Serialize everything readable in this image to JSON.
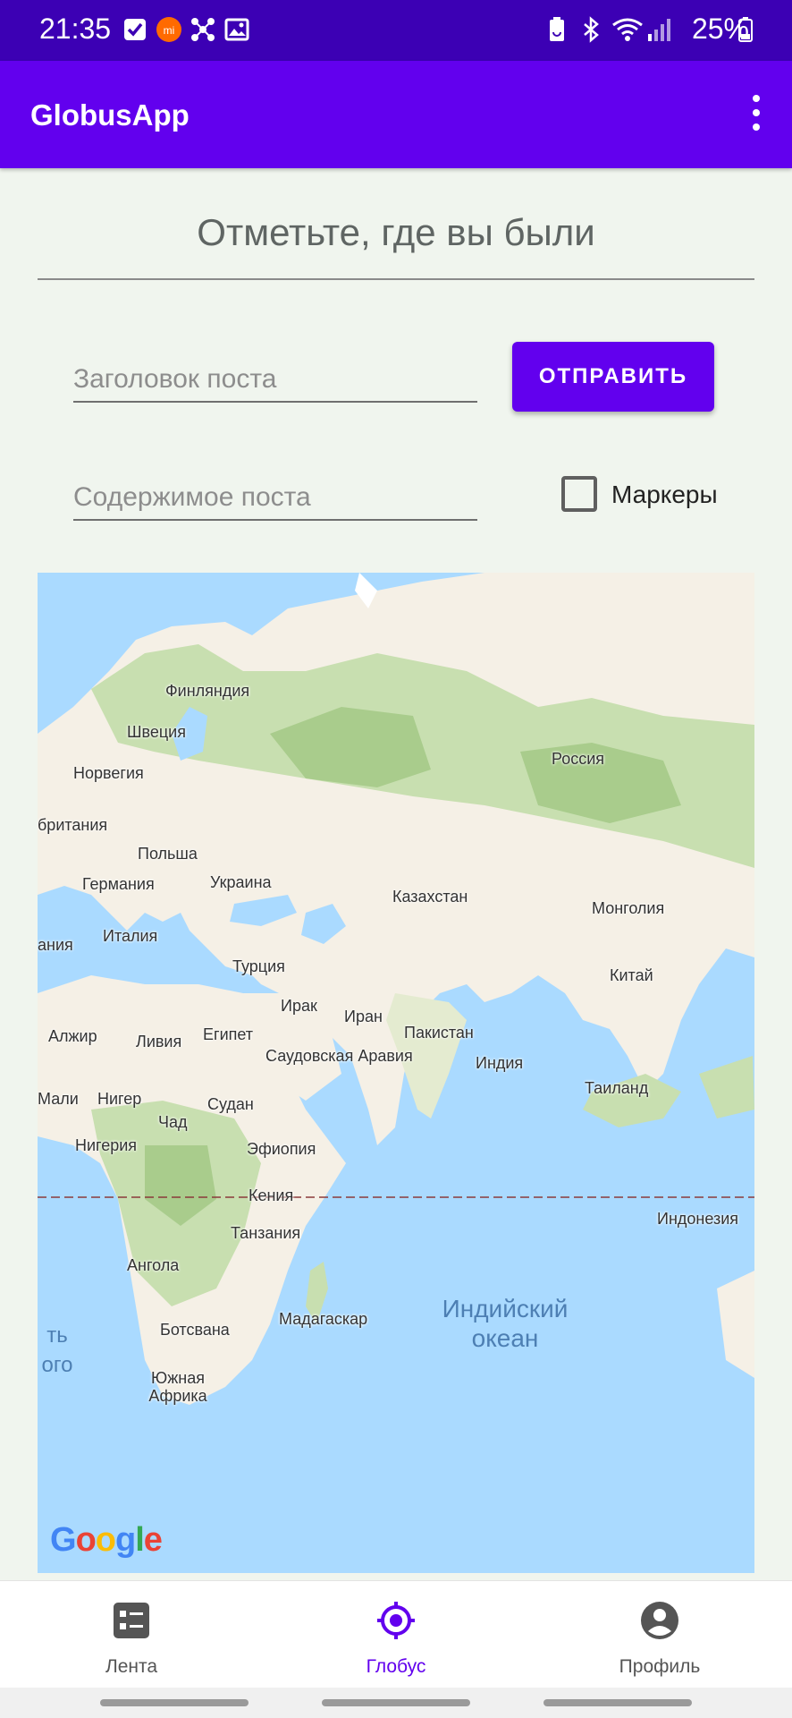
{
  "status_bar": {
    "time": "21:35",
    "battery": "25%",
    "icons": [
      "check-icon",
      "mi-icon",
      "network-icon",
      "image-icon",
      "battery-saver-icon",
      "bluetooth-icon",
      "wifi-icon",
      "signal-icon",
      "battery-icon"
    ]
  },
  "app_bar": {
    "title": "GlobusApp",
    "menu_icon": "more-vert-icon"
  },
  "page": {
    "heading": "Отметьте, где вы были",
    "title_placeholder": "Заголовок поста",
    "content_placeholder": "Содержимое поста",
    "send_label": "ОТПРАВИТЬ",
    "markers_label": "Маркеры",
    "markers_checked": false
  },
  "map": {
    "countries": [
      "Финляндия",
      "Швеция",
      "Норвегия",
      "Россия",
      "британия",
      "Польша",
      "Германия",
      "Украина",
      "Казахстан",
      "Монголия",
      "Италия",
      "Турция",
      "Китай",
      "Ирак",
      "Иран",
      "Пакистан",
      "Алжир",
      "Ливия",
      "Египет",
      "Саудовская Аравия",
      "Индия",
      "Мали",
      "Нигер",
      "Судан",
      "Таиланд",
      "Чад",
      "Нигерия",
      "Эфиопия",
      "Кения",
      "Индонезия",
      "Танзания",
      "Ангола",
      "Мадагаскар",
      "Ботсвана",
      "Южная Африка",
      "ания",
      "Индийский океан",
      "ть ого"
    ],
    "logo": "Google"
  },
  "bottom_nav": {
    "items": [
      {
        "label": "Лента",
        "icon": "feed-icon",
        "active": false
      },
      {
        "label": "Глобус",
        "icon": "globe-target-icon",
        "active": true
      },
      {
        "label": "Профиль",
        "icon": "profile-icon",
        "active": false
      }
    ]
  },
  "colors": {
    "status_bar": "#3c00b4",
    "primary": "#6200ee",
    "background": "#f0f5ee",
    "ocean": "#aadaff",
    "land": "#f5f0e6",
    "forest": "#c8dfb0"
  }
}
